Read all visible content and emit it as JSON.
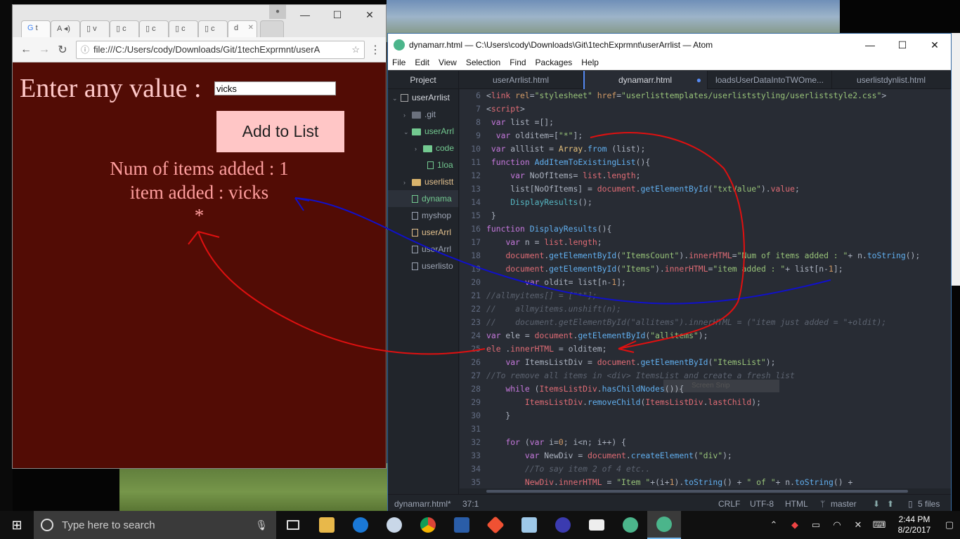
{
  "chrome": {
    "tabs": [
      "t",
      "A",
      "v",
      "c",
      "c",
      "c",
      "c",
      "d"
    ],
    "address": "file:///C:/Users/cody/Downloads/Git/1techExprmnt/userA",
    "page": {
      "prompt": "Enter any value :",
      "input_value": "vicks",
      "button": "Add to List",
      "count_text": "Num of items added : 1",
      "added_text": "item added : vicks",
      "all_items": "*"
    }
  },
  "atom": {
    "title": "dynamarr.html — C:\\Users\\cody\\Downloads\\Git\\1techExprmnt\\userArrlist — Atom",
    "menu": [
      "File",
      "Edit",
      "View",
      "Selection",
      "Find",
      "Packages",
      "Help"
    ],
    "project_tab": "Project",
    "tabs": [
      "userArrlist.html",
      "dynamarr.html",
      "loadsUserDataIntoTWOme...",
      "userlistdynlist.html"
    ],
    "tree": [
      "userArrlist",
      ".git",
      "userArrl",
      "code",
      "1loa",
      "userlistt",
      "dynama",
      "myshop",
      "userArrl",
      "userArrl",
      "userlisto"
    ],
    "status": {
      "file": "dynamarr.html*",
      "cursor": "37:1",
      "eol": "CRLF",
      "encoding": "UTF-8",
      "grammar": "HTML",
      "branch": "master",
      "files": "5 files"
    },
    "snip_label": "Screen Snip"
  },
  "taskbar": {
    "search_placeholder": "Type here to search",
    "time": "2:44 PM",
    "date": "8/2/2017"
  }
}
